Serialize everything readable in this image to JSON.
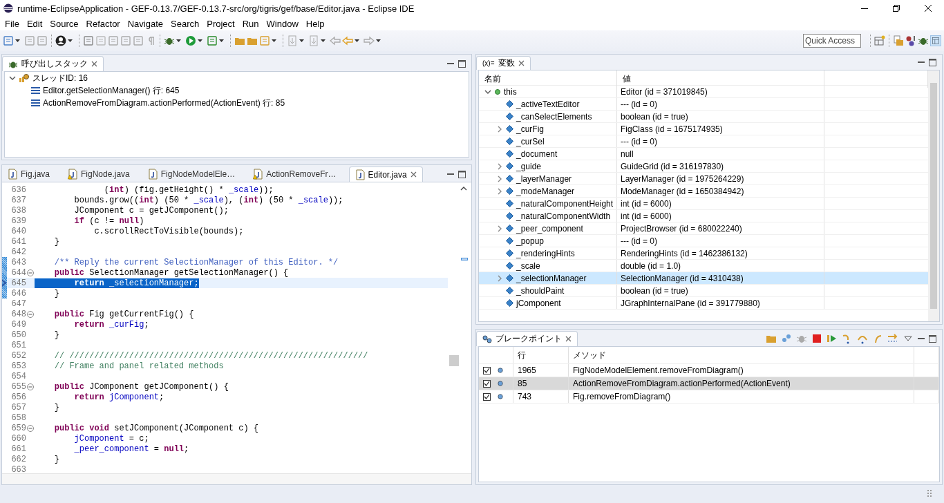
{
  "window": {
    "title": "runtime-EclipseApplication - GEF-0.13.7/GEF-0.13.7-src/org/tigris/gef/base/Editor.java - Eclipse IDE"
  },
  "menu": [
    "File",
    "Edit",
    "Source",
    "Refactor",
    "Navigate",
    "Search",
    "Project",
    "Run",
    "Window",
    "Help"
  ],
  "quick_access": {
    "placeholder": "Quick Access"
  },
  "call_stack": {
    "title": "呼び出しスタック",
    "thread": {
      "label": "スレッドID: 16",
      "expanded": true,
      "children": [
        {
          "label": "Editor.getSelectionManager() 行: 645"
        },
        {
          "label": "ActionRemoveFromDiagram.actionPerformed(ActionEvent) 行: 85"
        }
      ]
    }
  },
  "editor": {
    "tabs": [
      {
        "label": "Fig.java",
        "selected": false,
        "warning": false
      },
      {
        "label": "FigNode.java",
        "selected": false,
        "warning": true
      },
      {
        "label": "FigNodeModelEle…",
        "selected": false,
        "warning": false
      },
      {
        "label": "ActionRemoveFr…",
        "selected": false,
        "warning": true
      },
      {
        "label": "Editor.java",
        "selected": true,
        "warning": false
      }
    ],
    "lines": [
      {
        "number": "636",
        "segments": [
          {
            "kind": "plain",
            "text": "              ("
          },
          {
            "kind": "keyword",
            "text": "int"
          },
          {
            "kind": "plain",
            "text": ") (fig.getHeight() * "
          },
          {
            "kind": "field",
            "text": "_scale"
          },
          {
            "kind": "plain",
            "text": "));"
          }
        ]
      },
      {
        "number": "637",
        "segments": [
          {
            "kind": "plain",
            "text": "        bounds.grow(("
          },
          {
            "kind": "keyword",
            "text": "int"
          },
          {
            "kind": "plain",
            "text": ") (50 * "
          },
          {
            "kind": "field",
            "text": "_scale"
          },
          {
            "kind": "plain",
            "text": "), ("
          },
          {
            "kind": "keyword",
            "text": "int"
          },
          {
            "kind": "plain",
            "text": ") (50 * "
          },
          {
            "kind": "field",
            "text": "_scale"
          },
          {
            "kind": "plain",
            "text": "));"
          }
        ]
      },
      {
        "number": "638",
        "segments": [
          {
            "kind": "plain",
            "text": "        JComponent c = getJComponent();"
          }
        ]
      },
      {
        "number": "639",
        "segments": [
          {
            "kind": "keyword",
            "text": "        if"
          },
          {
            "kind": "plain",
            "text": " (c != "
          },
          {
            "kind": "keyword",
            "text": "null"
          },
          {
            "kind": "plain",
            "text": ")"
          }
        ]
      },
      {
        "number": "640",
        "segments": [
          {
            "kind": "plain",
            "text": "            c.scrollRectToVisible(bounds);"
          }
        ]
      },
      {
        "number": "641",
        "segments": [
          {
            "kind": "plain",
            "text": "    }"
          }
        ]
      },
      {
        "number": "642"
      },
      {
        "number": "643",
        "range": true,
        "segments": [
          {
            "kind": "javadoc",
            "text": "    /** Reply the current SelectionManager of this Editor. */"
          }
        ]
      },
      {
        "number": "644",
        "range": true,
        "fold": true,
        "segments": [
          {
            "kind": "keyword",
            "text": "    public"
          },
          {
            "kind": "plain",
            "text": " SelectionManager getSelectionManager() {"
          }
        ]
      },
      {
        "number": "645",
        "range": true,
        "current": true,
        "selected": true,
        "segments": [
          {
            "kind": "keyword",
            "text": "        return"
          },
          {
            "kind": "field",
            "text": " _selectionManager"
          },
          {
            "kind": "plain",
            "text": ";"
          }
        ]
      },
      {
        "number": "646",
        "range": true,
        "segments": [
          {
            "kind": "plain",
            "text": "    }"
          }
        ]
      },
      {
        "number": "647"
      },
      {
        "number": "648",
        "fold": true,
        "segments": [
          {
            "kind": "keyword",
            "text": "    public"
          },
          {
            "kind": "plain",
            "text": " Fig getCurrentFig() {"
          }
        ]
      },
      {
        "number": "649",
        "segments": [
          {
            "kind": "keyword",
            "text": "        return"
          },
          {
            "kind": "field",
            "text": " _curFig"
          },
          {
            "kind": "plain",
            "text": ";"
          }
        ]
      },
      {
        "number": "650",
        "segments": [
          {
            "kind": "plain",
            "text": "    }"
          }
        ]
      },
      {
        "number": "651"
      },
      {
        "number": "652",
        "segments": [
          {
            "kind": "comment",
            "text": "    // ////////////////////////////////////////////////////////////"
          }
        ]
      },
      {
        "number": "653",
        "segments": [
          {
            "kind": "comment",
            "text": "    // Frame and panel related methods"
          }
        ]
      },
      {
        "number": "654"
      },
      {
        "number": "655",
        "fold": true,
        "segments": [
          {
            "kind": "keyword",
            "text": "    public"
          },
          {
            "kind": "plain",
            "text": " JComponent getJComponent() {"
          }
        ]
      },
      {
        "number": "656",
        "segments": [
          {
            "kind": "keyword",
            "text": "        return"
          },
          {
            "kind": "field",
            "text": " jComponent"
          },
          {
            "kind": "plain",
            "text": ";"
          }
        ]
      },
      {
        "number": "657",
        "segments": [
          {
            "kind": "plain",
            "text": "    }"
          }
        ]
      },
      {
        "number": "658"
      },
      {
        "number": "659",
        "fold": true,
        "segments": [
          {
            "kind": "keyword",
            "text": "    public"
          },
          {
            "kind": "keyword",
            "text": " void"
          },
          {
            "kind": "plain",
            "text": " setJComponent(JComponent c) {"
          }
        ]
      },
      {
        "number": "660",
        "segments": [
          {
            "kind": "field",
            "text": "        jComponent"
          },
          {
            "kind": "plain",
            "text": " = c;"
          }
        ]
      },
      {
        "number": "661",
        "segments": [
          {
            "kind": "field",
            "text": "        _peer_component"
          },
          {
            "kind": "plain",
            "text": " = "
          },
          {
            "kind": "keyword",
            "text": "null"
          },
          {
            "kind": "plain",
            "text": ";"
          }
        ]
      },
      {
        "number": "662",
        "segments": [
          {
            "kind": "plain",
            "text": "    }"
          }
        ]
      },
      {
        "number": "663"
      }
    ]
  },
  "variables": {
    "title": "変数",
    "title_prefix": "(x)=",
    "columns": [
      "名前",
      "値"
    ],
    "root": {
      "name": "this",
      "value": "Editor (id = 371019845)",
      "expanded": true,
      "selected": false,
      "children": [
        {
          "name": "_activeTextEditor",
          "value": "--- (id = 0)",
          "expandable": false,
          "selected": false
        },
        {
          "name": "_canSelectElements",
          "value": "boolean (id = true)",
          "expandable": false,
          "selected": false
        },
        {
          "name": "_curFig",
          "value": "FigClass (id = 1675174935)",
          "expandable": true,
          "selected": false
        },
        {
          "name": "_curSel",
          "value": "--- (id = 0)",
          "expandable": false,
          "selected": false
        },
        {
          "name": "_document",
          "value": "null",
          "expandable": false,
          "selected": false
        },
        {
          "name": "_guide",
          "value": "GuideGrid (id = 316197830)",
          "expandable": true,
          "selected": false
        },
        {
          "name": "_layerManager",
          "value": "LayerManager (id = 1975264229)",
          "expandable": true,
          "selected": false
        },
        {
          "name": "_modeManager",
          "value": "ModeManager (id = 1650384942)",
          "expandable": true,
          "selected": false
        },
        {
          "name": "_naturalComponentHeight",
          "value": "int (id = 6000)",
          "expandable": false,
          "selected": false
        },
        {
          "name": "_naturalComponentWidth",
          "value": "int (id = 6000)",
          "expandable": false,
          "selected": false
        },
        {
          "name": "_peer_component",
          "value": "ProjectBrowser (id = 680022240)",
          "expandable": true,
          "selected": false
        },
        {
          "name": "_popup",
          "value": "--- (id = 0)",
          "expandable": false,
          "selected": false
        },
        {
          "name": "_renderingHints",
          "value": "RenderingHints (id = 1462386132)",
          "expandable": false,
          "selected": false
        },
        {
          "name": "_scale",
          "value": "double (id = 1.0)",
          "expandable": false,
          "selected": false
        },
        {
          "name": "_selectionManager",
          "value": "SelectionManager (id = 4310438)",
          "expandable": true,
          "selected": true
        },
        {
          "name": "_shouldPaint",
          "value": "boolean (id = true)",
          "expandable": false,
          "selected": false
        },
        {
          "name": "jComponent",
          "value": "JGraphInternalPane (id = 391779880)",
          "expandable": false,
          "selected": false
        }
      ]
    }
  },
  "breakpoints": {
    "title": "ブレークポイント",
    "columns": [
      "行",
      "メソッド"
    ],
    "rows": [
      {
        "checked": true,
        "line": "1965",
        "method": "FigNodeModelElement.removeFromDiagram()",
        "selected": false
      },
      {
        "checked": true,
        "line": "85",
        "method": "ActionRemoveFromDiagram.actionPerformed(ActionEvent)",
        "selected": true
      },
      {
        "checked": true,
        "line": "743",
        "method": "Fig.removeFromDiagram()",
        "selected": false
      }
    ]
  }
}
